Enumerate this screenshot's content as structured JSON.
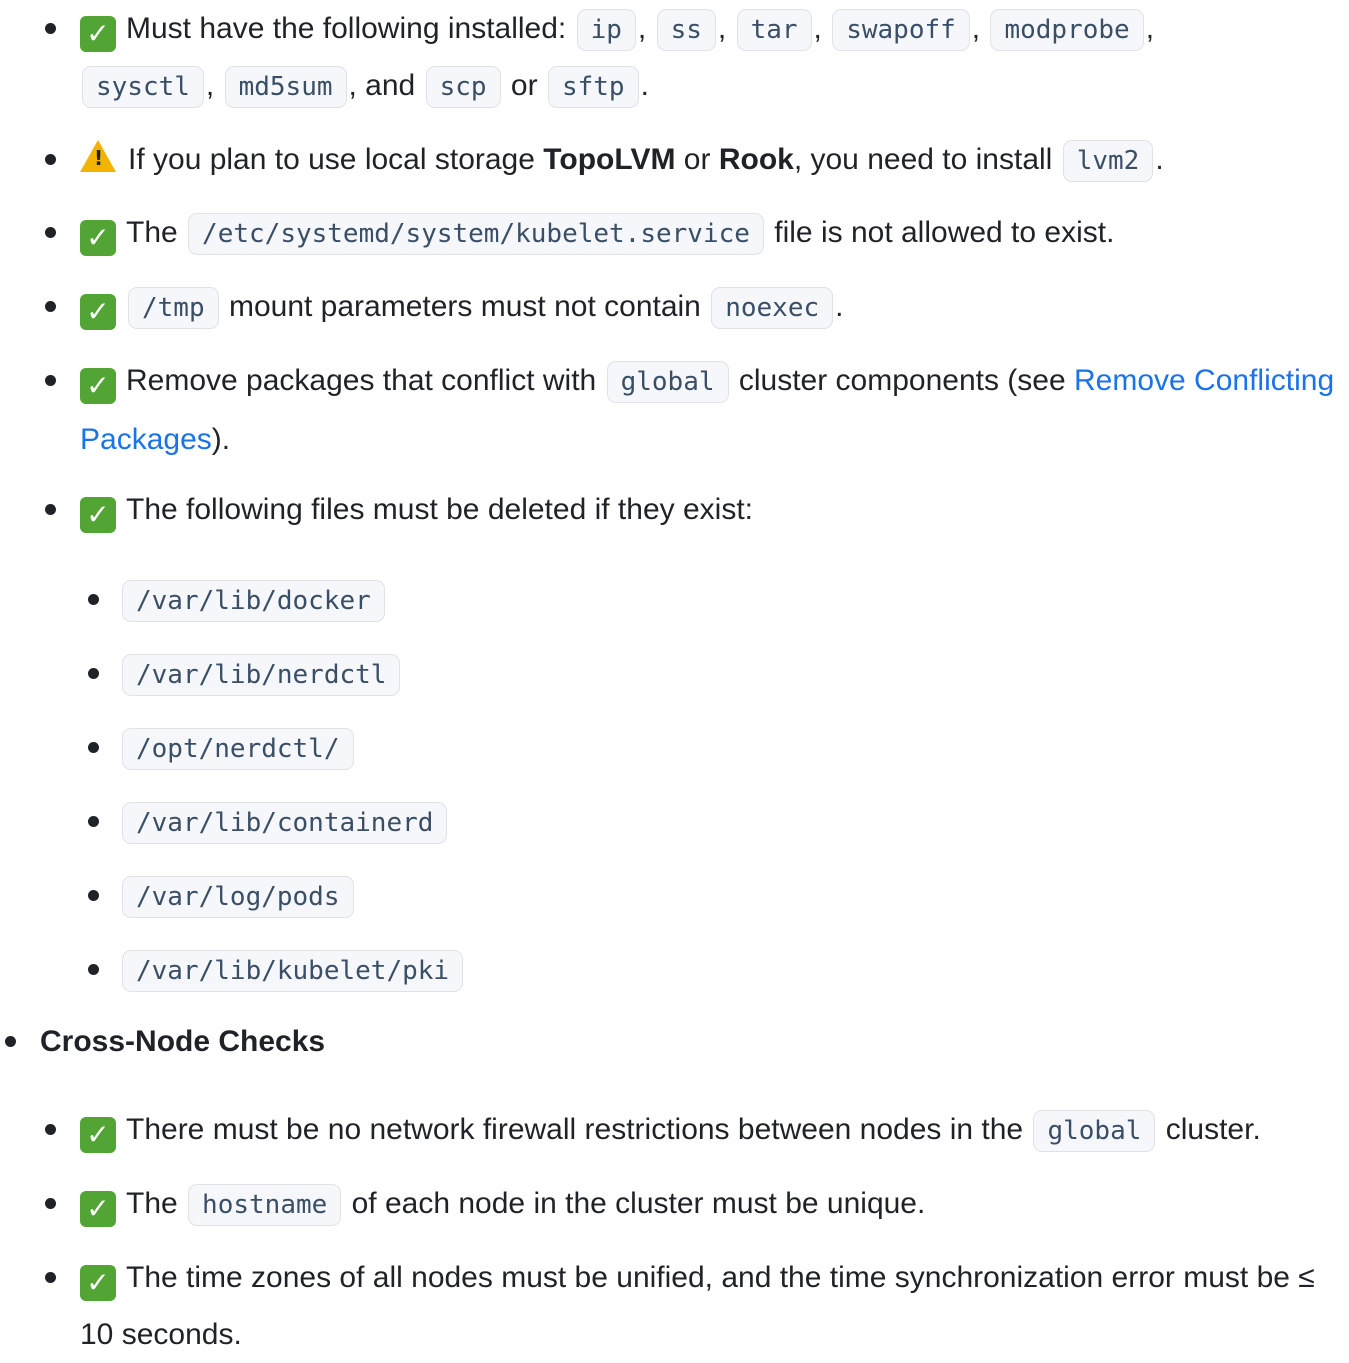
{
  "items": {
    "installed": {
      "prefix": "Must have the following installed:",
      "tools": [
        "ip",
        "ss",
        "tar",
        "swapoff",
        "modprobe",
        "sysctl",
        "md5sum"
      ],
      "and": ", and",
      "scp": "scp",
      "or": "or",
      "sftp": "sftp"
    },
    "lvm": {
      "pre": "If you plan to use local storage",
      "topolvm": "TopoLVM",
      "or": "or",
      "rook": "Rook",
      "post": ", you need to install",
      "pkg": "lvm2"
    },
    "kubelet_service": {
      "pre": "The",
      "path": "/etc/systemd/system/kubelet.service",
      "post": "file is not allowed to exist."
    },
    "tmp": {
      "path": "/tmp",
      "mid": "mount parameters must not contain",
      "opt": "noexec"
    },
    "conflict": {
      "pre": "Remove packages that conflict with",
      "code": "global",
      "mid": "cluster components (see",
      "link": "Remove Conflicting Packages",
      "post": ")."
    },
    "delete_files": {
      "text": "The following files must be deleted if they exist:",
      "files": [
        "/var/lib/docker",
        "/var/lib/nerdctl",
        "/opt/nerdctl/",
        "/var/lib/containerd",
        "/var/log/pods",
        "/var/lib/kubelet/pki"
      ]
    }
  },
  "cross_node": {
    "heading": "Cross-Node Checks",
    "firewall": {
      "pre": "There must be no network firewall restrictions between nodes in the",
      "code": "global",
      "post": "cluster."
    },
    "hostname": {
      "pre": "The",
      "code": "hostname",
      "post": "of each node in the cluster must be unique."
    },
    "time": {
      "text": "The time zones of all nodes must be unified, and the time synchronization error must be ≤ 10 seconds."
    }
  },
  "icons": {
    "check": "check-mark-icon",
    "warning": "warning-icon"
  },
  "colors": {
    "check": "#52a535",
    "warning": "#f2b400",
    "link": "#1a73e8",
    "code_text": "#3a4f66"
  }
}
